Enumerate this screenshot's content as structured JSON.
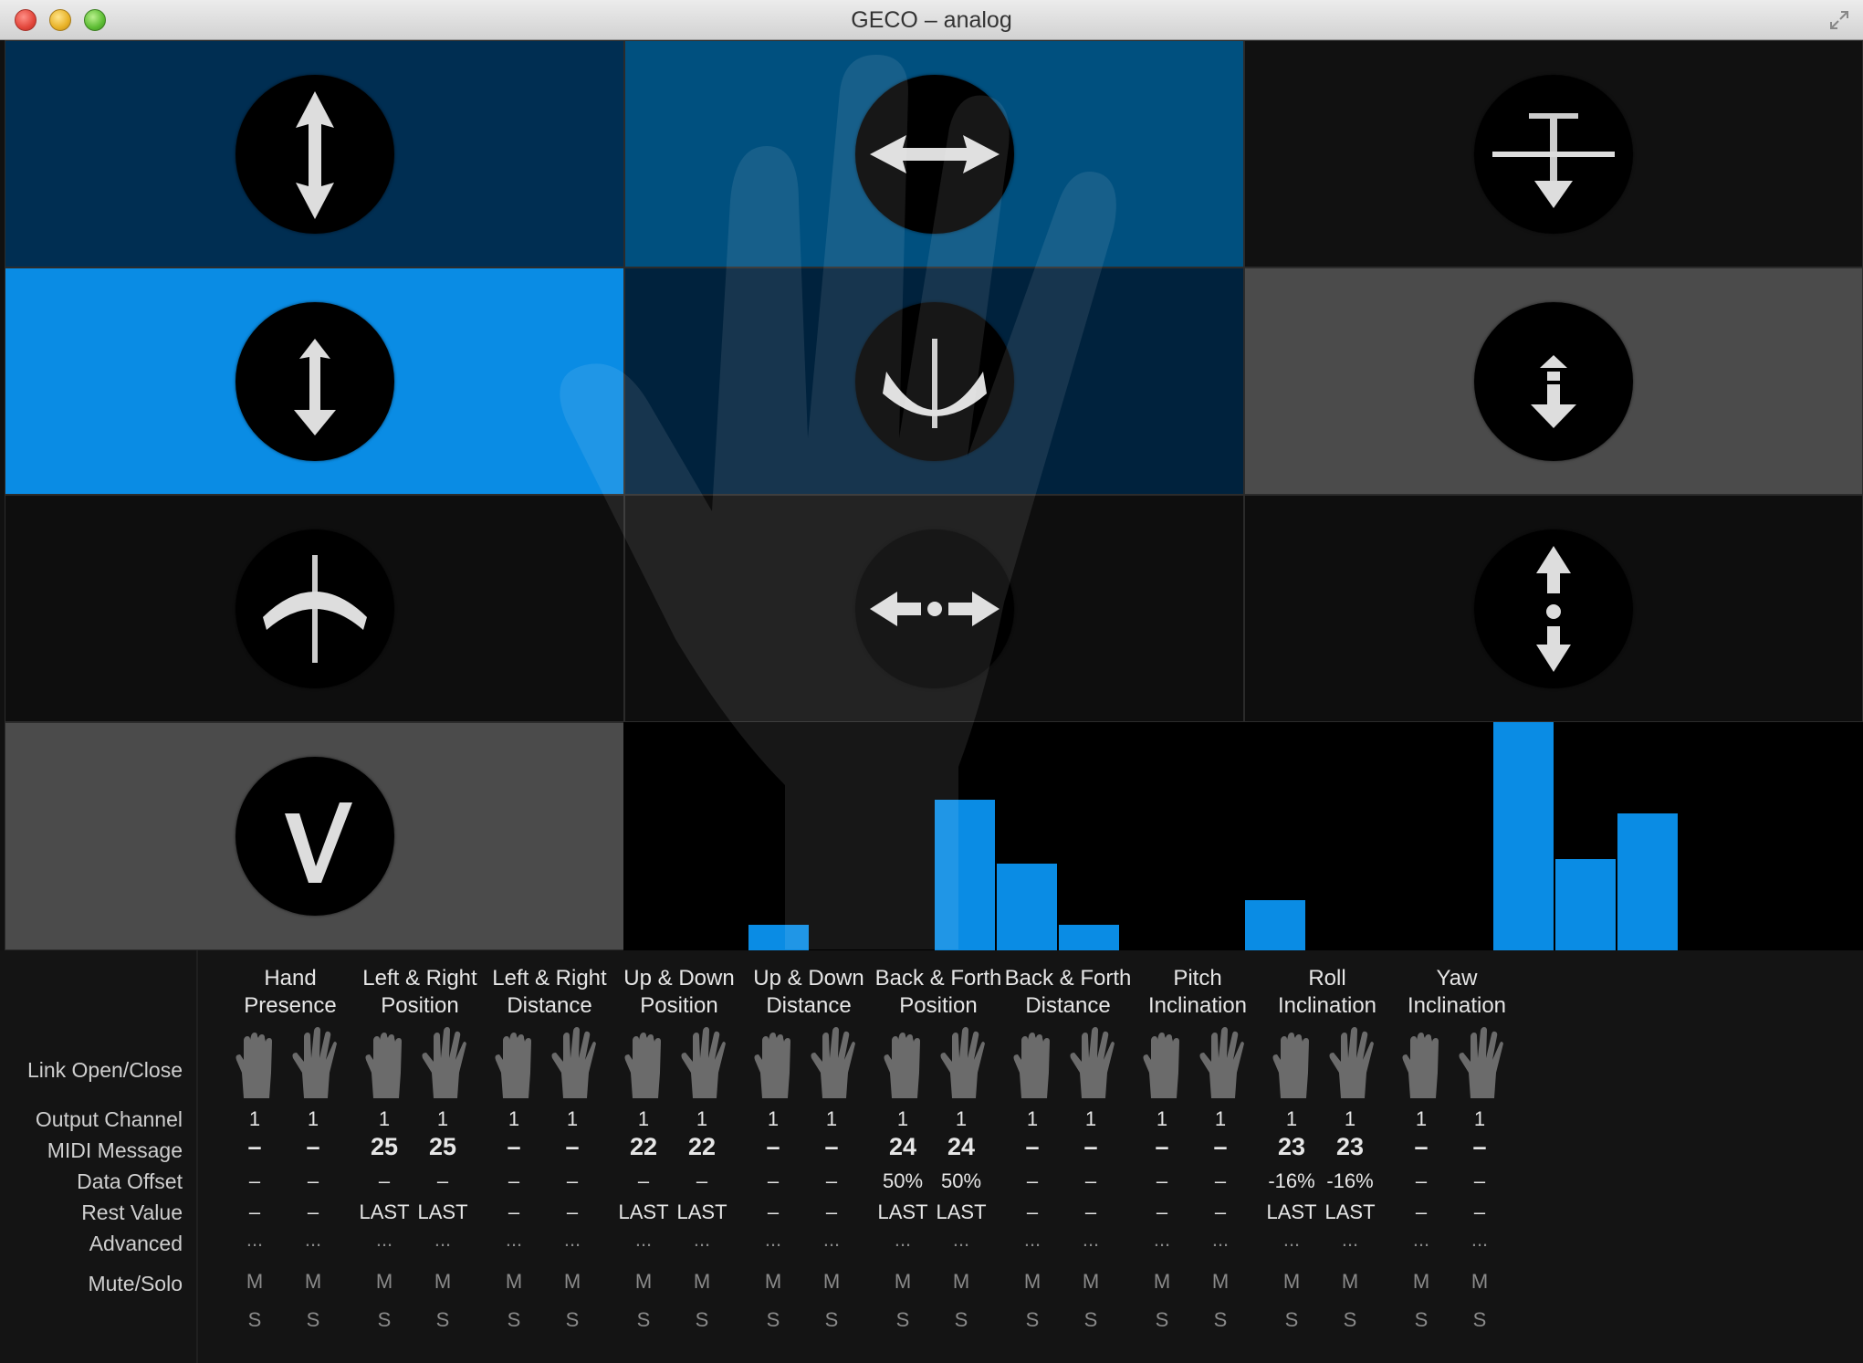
{
  "window": {
    "title": "GECO – analog"
  },
  "tiles": [
    {
      "id": "tile-1",
      "icon": "vertical-arrow-icon",
      "bg": "#002e52"
    },
    {
      "id": "tile-2",
      "icon": "horizontal-arrow-icon",
      "bg": "#00507f"
    },
    {
      "id": "tile-3",
      "icon": "down-from-plane-icon",
      "bg": "#111111"
    },
    {
      "id": "tile-4",
      "icon": "short-vertical-arrow-icon",
      "bg": "#0a8ce4"
    },
    {
      "id": "tile-5",
      "icon": "roll-rotation-icon",
      "bg": "#00223d"
    },
    {
      "id": "tile-6",
      "icon": "split-down-arrow-icon",
      "bg": "#4b4b4b"
    },
    {
      "id": "tile-7",
      "icon": "yaw-rotation-icon",
      "bg": "#0e0e0e"
    },
    {
      "id": "tile-8",
      "icon": "dotted-horizontal-arrow-icon",
      "bg": "#0e0e0e"
    },
    {
      "id": "tile-9",
      "icon": "dotted-vertical-arrow-icon",
      "bg": "#0e0e0e"
    },
    {
      "id": "tile-10",
      "icon": "checkmark-icon",
      "bg": "#4b4b4b"
    }
  ],
  "meter_levels": [
    0,
    0,
    0.11,
    0,
    0,
    0.66,
    0.38,
    0.11,
    0,
    0,
    0.22,
    0,
    0,
    0,
    1.0,
    0.4,
    0.6
  ],
  "columns": [
    {
      "line1": "Hand",
      "line2": "Presence"
    },
    {
      "line1": "Left & Right",
      "line2": "Position"
    },
    {
      "line1": "Left & Right",
      "line2": "Distance"
    },
    {
      "line1": "Up & Down",
      "line2": "Position"
    },
    {
      "line1": "Up & Down",
      "line2": "Distance"
    },
    {
      "line1": "Back & Forth",
      "line2": "Position"
    },
    {
      "line1": "Back & Forth",
      "line2": "Distance"
    },
    {
      "line1": "Pitch",
      "line2": "Inclination"
    },
    {
      "line1": "Roll",
      "line2": "Inclination"
    },
    {
      "line1": "Yaw",
      "line2": "Inclination"
    }
  ],
  "row_labels": {
    "link": "Link Open/Close",
    "channel": "Output Channel",
    "midi": "MIDI Message",
    "offset": "Data Offset",
    "rest": "Rest Value",
    "advanced": "Advanced",
    "mute": "Mute/Solo"
  },
  "values": {
    "channel": [
      "1",
      "1",
      "1",
      "1",
      "1",
      "1",
      "1",
      "1",
      "1",
      "1",
      "1",
      "1",
      "1",
      "1",
      "1",
      "1",
      "1",
      "1",
      "1",
      "1"
    ],
    "midi": [
      "–",
      "–",
      "25",
      "25",
      "–",
      "–",
      "22",
      "22",
      "–",
      "–",
      "24",
      "24",
      "–",
      "–",
      "–",
      "–",
      "23",
      "23",
      "–",
      "–"
    ],
    "offset": [
      "–",
      "–",
      "–",
      "–",
      "–",
      "–",
      "–",
      "–",
      "–",
      "–",
      "50%",
      "50%",
      "–",
      "–",
      "–",
      "–",
      "-16%",
      "-16%",
      "–",
      "–"
    ],
    "rest": [
      "–",
      "–",
      "LAST",
      "LAST",
      "–",
      "–",
      "LAST",
      "LAST",
      "–",
      "–",
      "LAST",
      "LAST",
      "–",
      "–",
      "–",
      "–",
      "LAST",
      "LAST",
      "–",
      "–"
    ],
    "advanced": [
      "...",
      "...",
      "...",
      "...",
      "...",
      "...",
      "...",
      "...",
      "...",
      "...",
      "...",
      "...",
      "...",
      "...",
      "...",
      "...",
      "...",
      "...",
      "...",
      "..."
    ],
    "mute": [
      "M",
      "M",
      "M",
      "M",
      "M",
      "M",
      "M",
      "M",
      "M",
      "M",
      "M",
      "M",
      "M",
      "M",
      "M",
      "M",
      "M",
      "M",
      "M",
      "M"
    ],
    "solo": [
      "S",
      "S",
      "S",
      "S",
      "S",
      "S",
      "S",
      "S",
      "S",
      "S",
      "S",
      "S",
      "S",
      "S",
      "S",
      "S",
      "S",
      "S",
      "S",
      "S"
    ]
  }
}
